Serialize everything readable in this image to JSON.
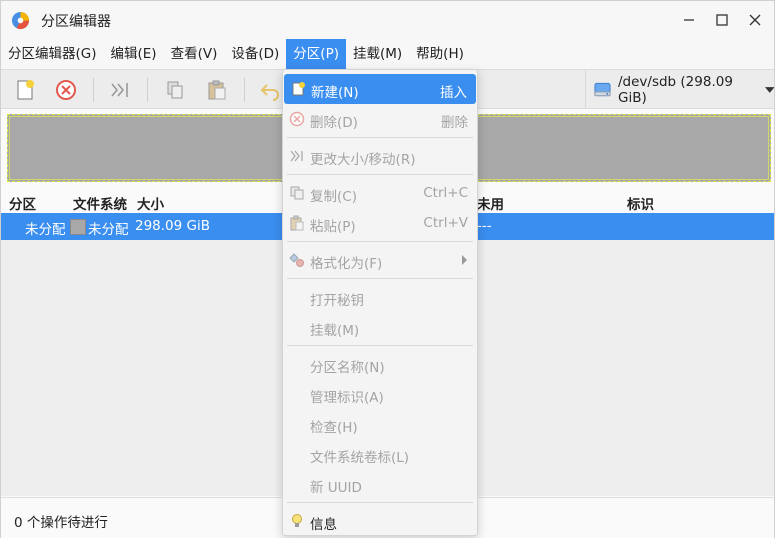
{
  "window": {
    "title": "分区编辑器"
  },
  "menubar": {
    "items": [
      "分区编辑器(G)",
      "编辑(E)",
      "查看(V)",
      "设备(D)",
      "分区(P)",
      "挂载(M)",
      "帮助(H)"
    ]
  },
  "toolbar": {
    "device_label": "/dev/sdb (298.09 GiB)"
  },
  "table": {
    "headers": [
      "分区",
      "文件系统",
      "大小",
      "未用",
      "标识"
    ],
    "rows": [
      {
        "partition": "未分配",
        "filesystem": "未分配",
        "size": "298.09 GiB",
        "unused": "---",
        "flags": ""
      }
    ]
  },
  "statusbar": {
    "text": "0 个操作待进行"
  },
  "partition_menu": {
    "items": [
      {
        "label": "新建(N)",
        "shortcut": "插入",
        "icon": "new-partition-icon",
        "enabled": true,
        "highlighted": true
      },
      {
        "label": "删除(D)",
        "shortcut": "删除",
        "icon": "delete-icon",
        "enabled": false
      },
      {
        "label": "更改大小/移动(R)",
        "shortcut": "",
        "icon": "resize-icon",
        "enabled": false
      },
      {
        "label": "复制(C)",
        "shortcut": "Ctrl+C",
        "icon": "copy-icon",
        "enabled": false
      },
      {
        "label": "粘贴(P)",
        "shortcut": "Ctrl+V",
        "icon": "paste-icon",
        "enabled": false
      },
      {
        "label": "格式化为(F)",
        "shortcut": "",
        "icon": "format-icon",
        "enabled": false,
        "submenu": true
      },
      {
        "label": "打开秘钥",
        "shortcut": "",
        "enabled": false
      },
      {
        "label": "挂载(M)",
        "shortcut": "",
        "enabled": false
      },
      {
        "label": "分区名称(N)",
        "shortcut": "",
        "enabled": false
      },
      {
        "label": "管理标识(A)",
        "shortcut": "",
        "enabled": false
      },
      {
        "label": "检查(H)",
        "shortcut": "",
        "enabled": false
      },
      {
        "label": "文件系统卷标(L)",
        "shortcut": "",
        "enabled": false
      },
      {
        "label": "新 UUID",
        "shortcut": "",
        "enabled": false
      },
      {
        "label": "信息",
        "shortcut": "",
        "icon": "info-bulb-icon",
        "enabled": true
      }
    ]
  },
  "colors": {
    "accent": "#3a8ef0",
    "unallocated": "#a8a8a8"
  }
}
